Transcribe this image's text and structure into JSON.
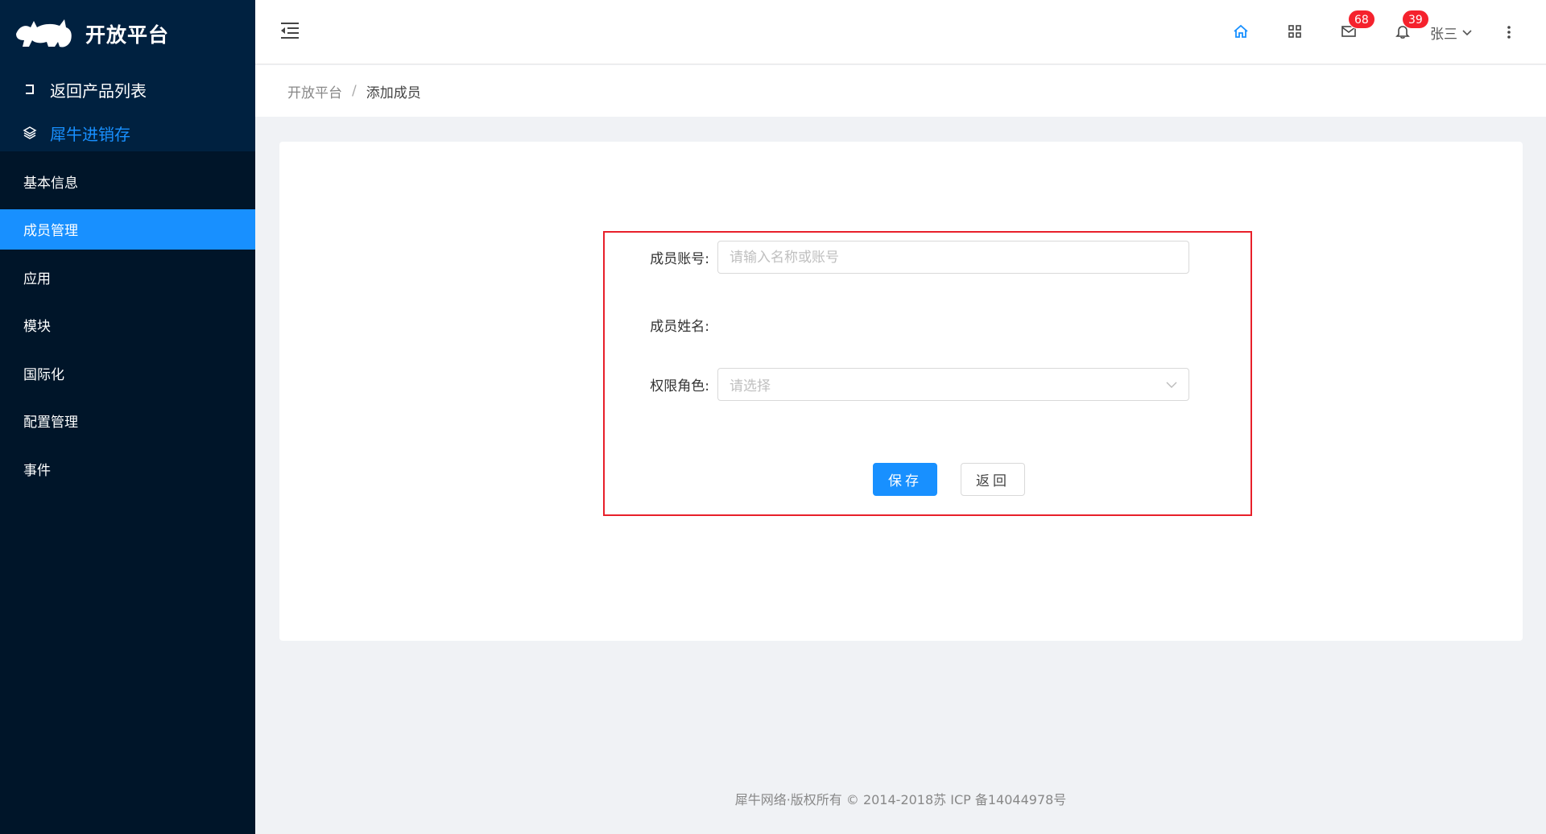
{
  "app": {
    "title": "开放平台"
  },
  "sidebar": {
    "back_link": "返回产品列表",
    "product_link": "犀牛进销存",
    "items": [
      {
        "label": "基本信息"
      },
      {
        "label": "成员管理"
      },
      {
        "label": "应用"
      },
      {
        "label": "模块"
      },
      {
        "label": "国际化"
      },
      {
        "label": "配置管理"
      },
      {
        "label": "事件"
      }
    ],
    "selected": "成员管理"
  },
  "header": {
    "mail_count": "68",
    "notify_count": "39",
    "user_name": "张三",
    "accent_color": "#1890ff"
  },
  "breadcrumb": {
    "root": "开放平台",
    "separator": "/",
    "current": "添加成员"
  },
  "form": {
    "account_label": "成员账号:",
    "account_placeholder": "请输入名称或账号",
    "name_label": "成员姓名:",
    "name_value": "",
    "role_label": "权限角色:",
    "role_placeholder": "请选择",
    "save_label": "保存",
    "back_label": "返回"
  },
  "footer": {
    "text": "犀牛网络·版权所有 © 2014-2018苏 ICP 备14044978号"
  }
}
